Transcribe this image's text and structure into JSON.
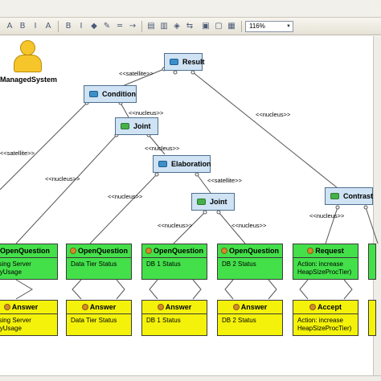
{
  "toolbar": {
    "zoom": "116%"
  },
  "actor": {
    "label": "ManagedSystem"
  },
  "relations": {
    "result": "Result",
    "condition": "Condition",
    "joint1": "Joint",
    "elaboration": "Elaboration",
    "joint2": "Joint",
    "contrast": "Contrast"
  },
  "edge_labels": {
    "satellite1": "<<satellite>>",
    "nucleus_result": "<<nucleus>>",
    "nucleus_cond": "<<nucleus>>",
    "satellite_left": "<<satellite>>",
    "nucleus_left": "<<nucleus>>",
    "nucleus_joint1": "<<nucleus>>",
    "satellite_elab": "<<satellite>>",
    "nucleus_elab": "<<nucleus>>",
    "nucleus_j2a": "<<nucleus>>",
    "nucleus_j2b": "<<nucleus>>",
    "nucleus_contrast": "<<nucleus>>"
  },
  "green_nodes": [
    {
      "title": "OpenQuestion",
      "line1": "cessing Server",
      "line2": "moryUsage"
    },
    {
      "title": "OpenQuestion",
      "line1": "Data Tier Status",
      "line2": ""
    },
    {
      "title": "OpenQuestion",
      "line1": "DB 1 Status",
      "line2": ""
    },
    {
      "title": "OpenQuestion",
      "line1": "DB 2 Status",
      "line2": ""
    },
    {
      "title": "Request",
      "line1": "Action: increase",
      "line2": "HeapSizeProcTier)"
    }
  ],
  "yellow_nodes": [
    {
      "title": "Answer",
      "line1": "cessing Server",
      "line2": "moryUsage"
    },
    {
      "title": "Answer",
      "line1": "Data Tier Status",
      "line2": ""
    },
    {
      "title": "Answer",
      "line1": "DB 1 Status",
      "line2": ""
    },
    {
      "title": "Answer",
      "line1": "DB 2 Status",
      "line2": ""
    },
    {
      "title": "Accept",
      "line1": "Action: increase",
      "line2": "HeapSizeProcTier)"
    }
  ]
}
